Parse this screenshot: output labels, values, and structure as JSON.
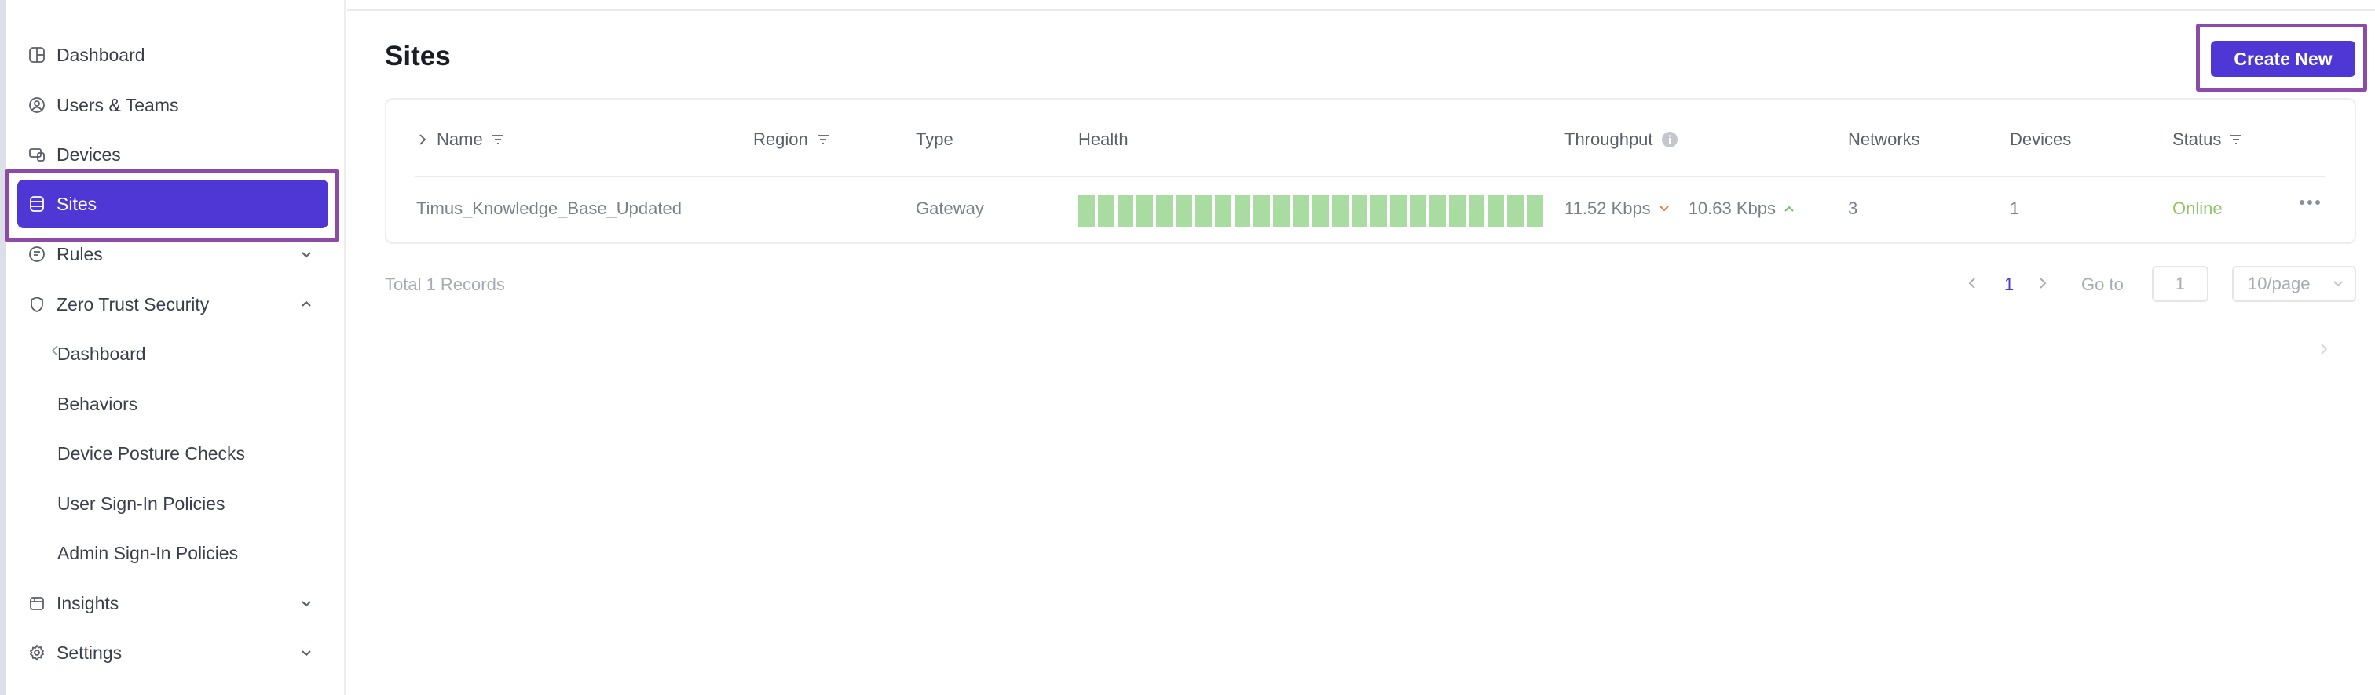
{
  "sidebar": {
    "items": [
      {
        "label": "Dashboard",
        "icon": "dashboard-icon"
      },
      {
        "label": "Users & Teams",
        "icon": "user-circle-icon"
      },
      {
        "label": "Devices",
        "icon": "devices-icon"
      },
      {
        "label": "Sites",
        "icon": "sites-icon"
      },
      {
        "label": "Rules",
        "icon": "rules-icon"
      },
      {
        "label": "Zero Trust Security",
        "icon": "shield-icon"
      },
      {
        "label": "Insights",
        "icon": "insights-icon"
      },
      {
        "label": "Settings",
        "icon": "settings-icon"
      }
    ],
    "sub_items": [
      "Dashboard",
      "Behaviors",
      "Device Posture Checks",
      "User Sign-In Policies",
      "Admin Sign-In Policies"
    ]
  },
  "page": {
    "title": "Sites",
    "create_label": "Create New"
  },
  "table": {
    "columns": [
      "Name",
      "Region",
      "Type",
      "Health",
      "Throughput",
      "Networks",
      "Devices",
      "Status"
    ],
    "rows": [
      {
        "name": "Timus_Knowledge_Base_Updated",
        "region": "",
        "type": "Gateway",
        "health_bars": 24,
        "throughput_down": "11.52 Kbps",
        "throughput_up": "10.63 Kbps",
        "networks": "3",
        "devices": "1",
        "status": "Online"
      }
    ]
  },
  "pagination": {
    "total": "Total 1  Records",
    "current": "1",
    "goto_label": "Go to",
    "goto_value": "1",
    "page_size": "10/page"
  },
  "colors": {
    "accent": "#4f37d6",
    "highlight": "#8e4aa8",
    "online": "#92c46d",
    "health": "#a8dca0"
  }
}
